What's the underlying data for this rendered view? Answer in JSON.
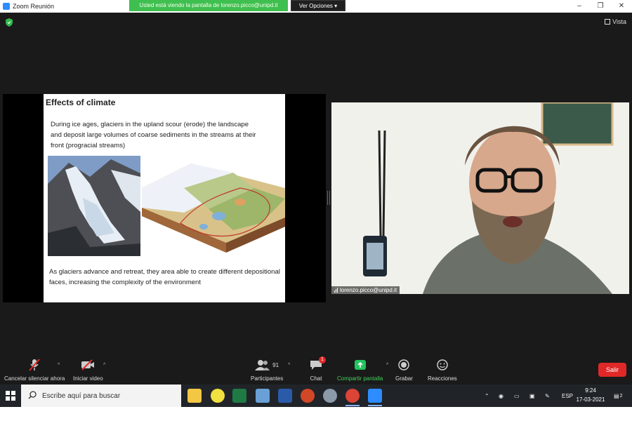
{
  "window": {
    "title": "Zoom Reunión"
  },
  "share_banner": {
    "text": "Usted está viendo la pantalla de lorenzo.picco@unipd.it"
  },
  "view_options": {
    "label": "Ver Opciones"
  },
  "view_button": {
    "label": "Vista"
  },
  "slide": {
    "title": "Effects of climate",
    "paragraph1": "During ice ages, glaciers in the upland scour (erode) the landscape and deposit large volumes of coarse sediments in the streams at their front (progracial streams)",
    "paragraph2": "As glaciers advance and retreat, they area able to create different depositional faces, increasing the complexity of the environment"
  },
  "participant_video": {
    "name": "lorenzo.picco@unipd.it"
  },
  "toolbar": {
    "mute": "Cancelar silenciar ahora",
    "video": "Iniciar video",
    "participants": "Participantes",
    "participants_count": "91",
    "chat": "Chat",
    "chat_badge": "1",
    "share": "Compartir pantalla",
    "record": "Grabar",
    "reactions": "Reacciones",
    "leave": "Salir"
  },
  "taskbar": {
    "search_placeholder": "Escribe aquí para buscar",
    "language": "ESP",
    "time": "9:24",
    "date": "17-03-2021",
    "notification_count": "2"
  },
  "colors": {
    "share_banner": "#3fbf4f",
    "leave": "#e02828",
    "share_icon": "#22c55e",
    "chat_badge": "#e02828"
  }
}
